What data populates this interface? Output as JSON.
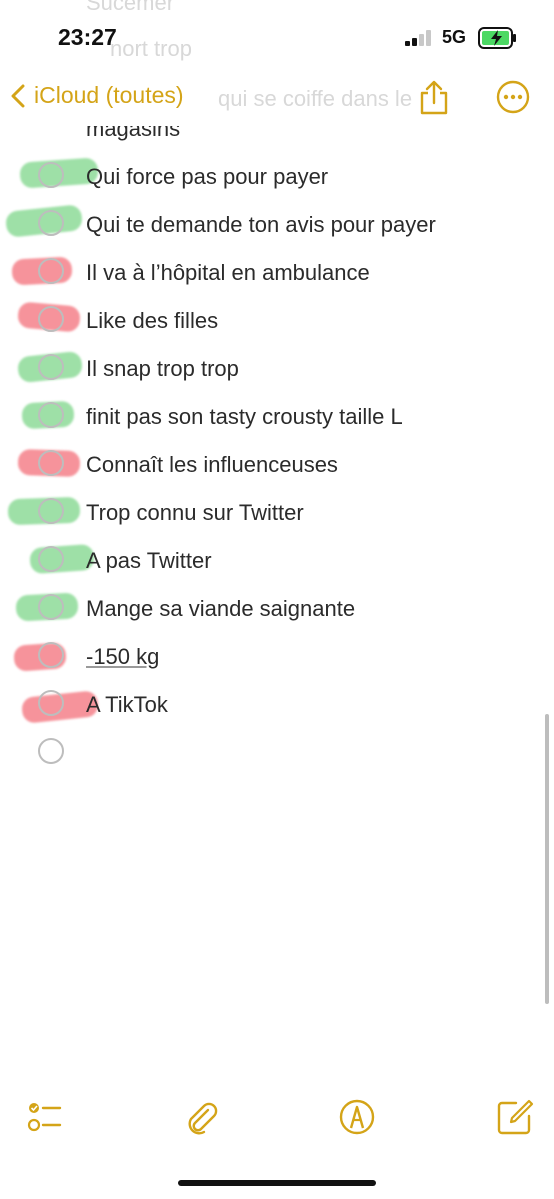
{
  "status": {
    "time": "23:27",
    "network": "5G"
  },
  "nav": {
    "back_label": "iCloud (toutes)"
  },
  "ghost_lines": [
    "Sucemer",
    "nort trop",
    "qui se coiffe dans le"
  ],
  "cut_line": "magasins",
  "items": [
    {
      "label": "Qui force pas pour payer",
      "mark": "green"
    },
    {
      "label": "Qui te demande ton avis pour payer",
      "mark": "green"
    },
    {
      "label": "Il va à l’hôpital en ambulance",
      "mark": "red"
    },
    {
      "label": "Like des filles",
      "mark": "red"
    },
    {
      "label": "Il snap trop trop",
      "mark": "green"
    },
    {
      "label": "finit pas son tasty crousty taille L",
      "mark": "green"
    },
    {
      "label": "Connaît les influenceuses",
      "mark": "red"
    },
    {
      "label": "Trop connu sur Twitter",
      "mark": "green"
    },
    {
      "label": "A pas Twitter",
      "mark": "green"
    },
    {
      "label": "Mange sa viande saignante",
      "mark": "green"
    },
    {
      "label": "-150 kg",
      "mark": "red"
    },
    {
      "label": "A TikTok",
      "mark": "red"
    },
    {
      "label": "",
      "mark": "none"
    }
  ],
  "colors": {
    "accent": "#d4a418",
    "green_marker": "#7ed68a",
    "red_marker": "#f3707a"
  }
}
